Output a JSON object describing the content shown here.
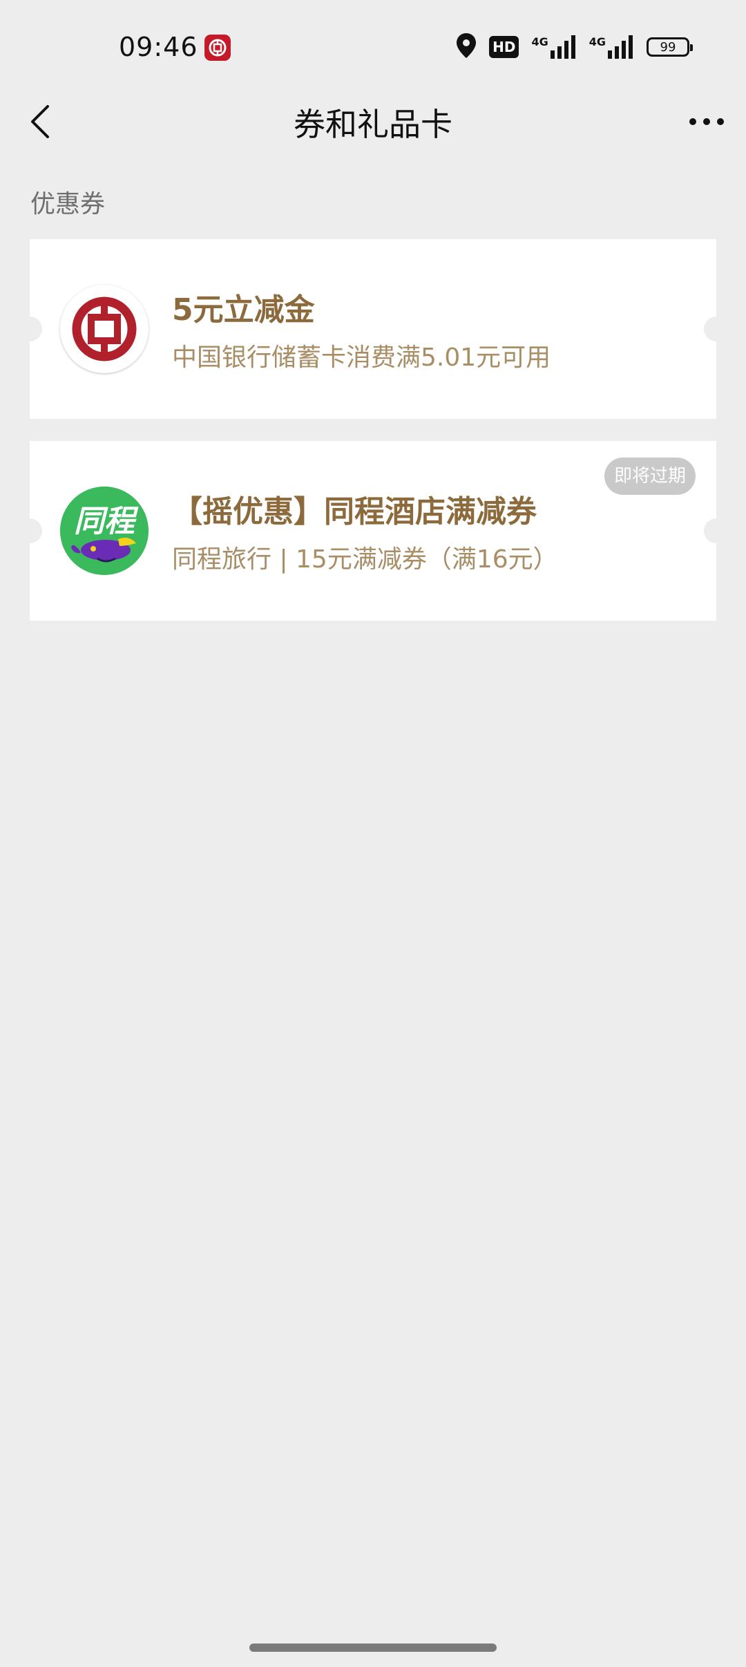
{
  "status_bar": {
    "time": "09:46",
    "network_1": "4G",
    "network_2": "4G",
    "hd_label": "HD",
    "battery": "99"
  },
  "nav": {
    "title": "券和礼品卡"
  },
  "section": {
    "label": "优惠券"
  },
  "coupons": [
    {
      "title": "5元立减金",
      "subtitle": "中国银行储蓄卡消费满5.01元可用",
      "logo_icon": "bank-of-china-logo"
    },
    {
      "title": "【摇优惠】同程酒店满减券",
      "subtitle": "同程旅行 | 15元满减券（满16元）",
      "logo_icon": "tongcheng-logo",
      "logo_text": "同程",
      "badge": "即将过期"
    }
  ],
  "colors": {
    "background": "#ededed",
    "coupon_title": "#8c6a3b",
    "coupon_subtitle": "#a88d65",
    "boc_red": "#c41a2a",
    "tongcheng_green": "#3aba5c"
  }
}
